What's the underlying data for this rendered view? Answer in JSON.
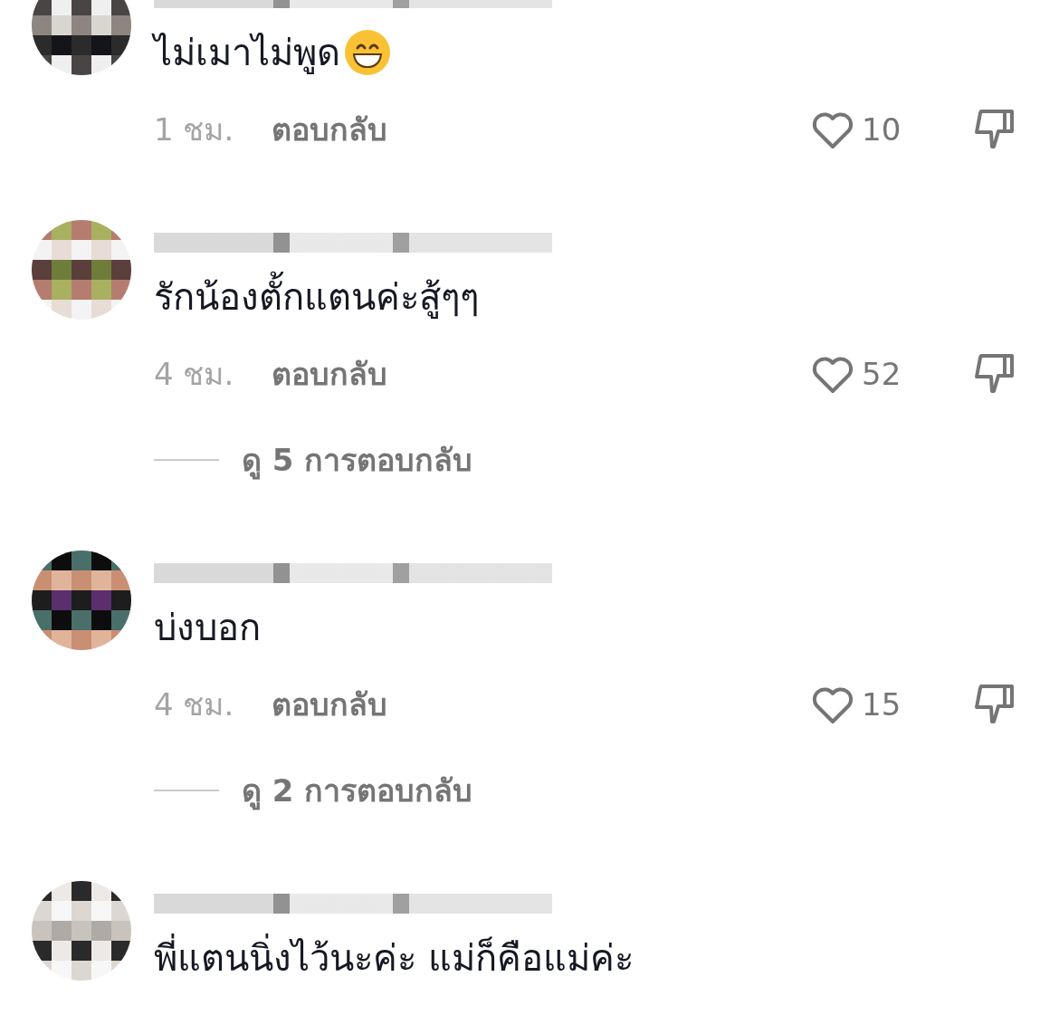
{
  "comments": [
    {
      "text": "ไม่เมาไม่พูด",
      "grin_emoji": true,
      "time": "1 ชม.",
      "reply": "ตอบกลับ",
      "likes": "10"
    },
    {
      "text": "รักน้องตั้กแตนค่ะสู้ๆๆ",
      "time": "4 ชม.",
      "reply": "ตอบกลับ",
      "likes": "52",
      "view_replies": "ดู 5 การตอบกลับ"
    },
    {
      "text": "บ่งบอก",
      "time": "4 ชม.",
      "reply": "ตอบกลับ",
      "likes": "15",
      "view_replies": "ดู 2 การตอบกลับ"
    },
    {
      "text": "พี่แตนนิ่งไว้นะค่ะ แม่ก็คือแม่ค่ะ"
    }
  ]
}
